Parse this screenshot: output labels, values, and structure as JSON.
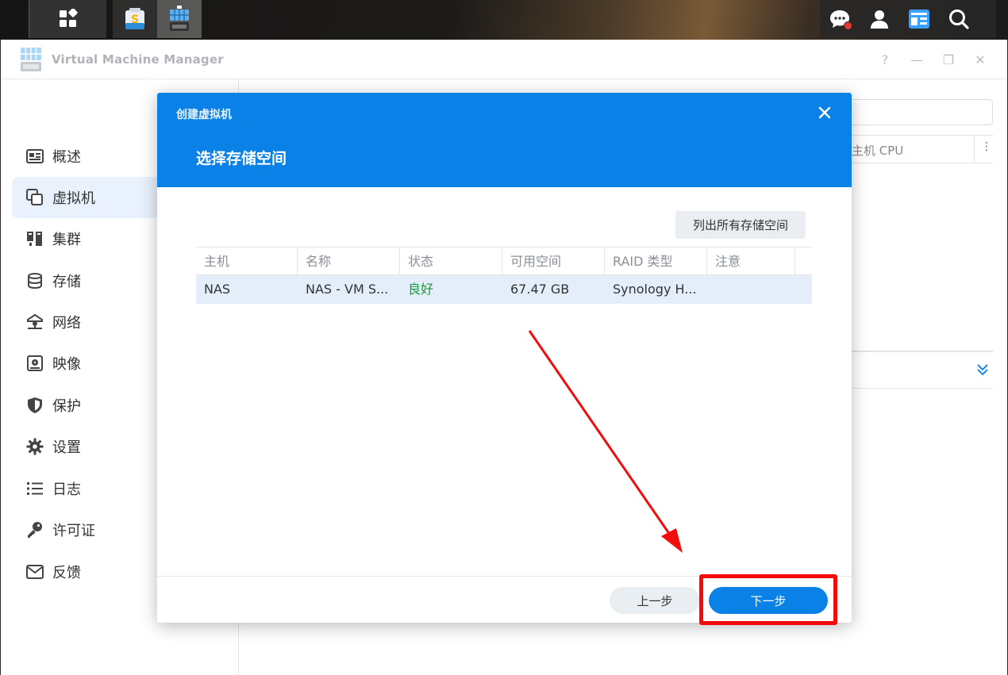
{
  "taskbar": {
    "main_menu_icon": "apps-grid-icon",
    "apps": [
      {
        "name": "synology-office-icon"
      },
      {
        "name": "virtual-machine-manager-icon"
      }
    ],
    "right_icons": [
      "notification-chat-icon",
      "user-icon",
      "widgets-icon",
      "search-icon"
    ],
    "notification_badge_color": "#e53935"
  },
  "window": {
    "title": "Virtual Machine Manager",
    "controls": {
      "help": "?",
      "minimize": "—",
      "restore": "❐",
      "close": "✕"
    }
  },
  "sidebar": {
    "items": [
      {
        "label": "概述",
        "icon": "overview-icon",
        "active": false
      },
      {
        "label": "虚拟机",
        "icon": "virtual-machine-icon",
        "active": true
      },
      {
        "label": "集群",
        "icon": "cluster-icon",
        "active": false
      },
      {
        "label": "存储",
        "icon": "storage-icon",
        "active": false
      },
      {
        "label": "网络",
        "icon": "network-icon",
        "active": false
      },
      {
        "label": "映像",
        "icon": "image-icon",
        "active": false
      },
      {
        "label": "保护",
        "icon": "shield-icon",
        "active": false
      },
      {
        "label": "设置",
        "icon": "gear-icon",
        "active": false
      },
      {
        "label": "日志",
        "icon": "log-list-icon",
        "active": false
      },
      {
        "label": "许可证",
        "icon": "key-icon",
        "active": false
      },
      {
        "label": "反馈",
        "icon": "mail-icon",
        "active": false
      }
    ]
  },
  "background": {
    "column_cpu": "主机 CPU",
    "column_menu": "⋮"
  },
  "dialog": {
    "title": "创建虚拟机",
    "subtitle": "选择存储空间",
    "list_all_button": "列出所有存储空间",
    "table": {
      "headers": [
        "主机",
        "名称",
        "状态",
        "可用空间",
        "RAID 类型",
        "注意"
      ],
      "rows": [
        {
          "host": "NAS",
          "name": "NAS - VM S...",
          "status": "良好",
          "free_space": "67.47 GB",
          "raid_type": "Synology H...",
          "note": ""
        }
      ]
    },
    "prev_button": "上一步",
    "next_button": "下一步"
  },
  "colors": {
    "accent": "#0a81e6",
    "status_good": "#1a9b3c",
    "annotation": "#f20d0d",
    "selected_row": "#e3eefa"
  }
}
